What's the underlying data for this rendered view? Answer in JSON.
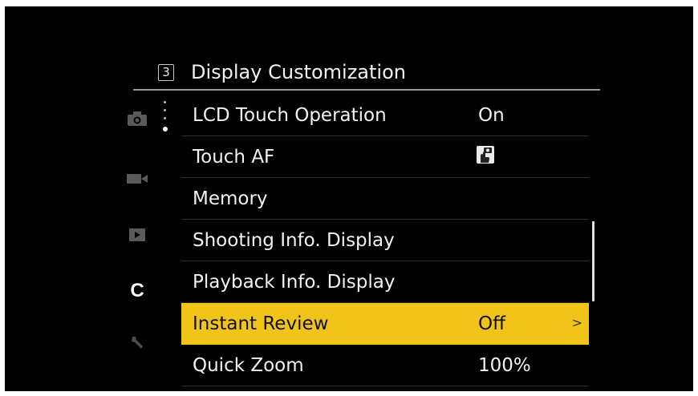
{
  "header": {
    "page_number": "3",
    "title": "Display Customization"
  },
  "sidebar": {
    "tabs": [
      {
        "icon": "camera-icon",
        "active": false
      },
      {
        "icon": "video-icon",
        "active": false
      },
      {
        "icon": "playback-icon",
        "active": false
      },
      {
        "icon": "custom-c-icon",
        "label": "C",
        "active": true
      },
      {
        "icon": "wrench-icon",
        "active": false
      }
    ]
  },
  "menu": {
    "items": [
      {
        "label": "LCD Touch Operation",
        "value": "On"
      },
      {
        "label": "Touch AF",
        "value_icon": "touch-af-icon"
      },
      {
        "label": "Memory",
        "value": ""
      },
      {
        "label": "Shooting Info. Display",
        "value": ""
      },
      {
        "label": "Playback Info. Display",
        "value": ""
      },
      {
        "label": "Instant Review",
        "value": "Off",
        "selected": true,
        "submenu_glyph": ">"
      },
      {
        "label": "Quick Zoom",
        "value": "100%"
      }
    ]
  },
  "colors": {
    "selection": "#f0c419",
    "background": "#000000",
    "text": "#f2f2f2"
  }
}
